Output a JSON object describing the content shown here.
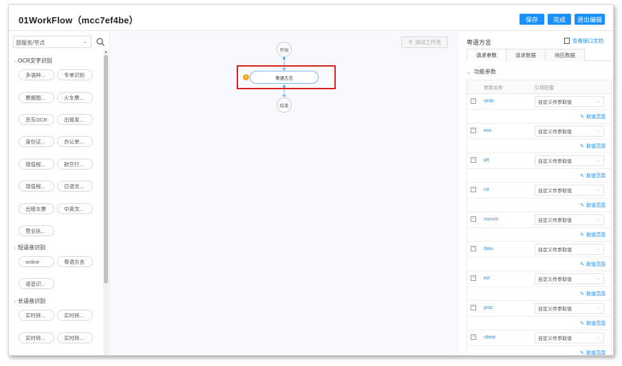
{
  "header": {
    "title": "01WorkFlow（mcc7ef4be）",
    "save_label": "保存",
    "done_label": "完成",
    "exit_label": "退出编辑"
  },
  "sidebar": {
    "select_value": "部服务/节点",
    "groups": [
      {
        "label": "OCR文字识别",
        "items": [
          "多语种...",
          "专单识别",
          "票据图...",
          "火车票...",
          "京东OCR",
          "出租发...",
          "身份证...",
          "办公单...",
          "增值税...",
          "航空行...",
          "增值税...",
          "日语文...",
          "出租车票",
          "中英文...",
          "营业执..."
        ]
      },
      {
        "label": "短语音识别",
        "items": [
          "online",
          "粤语方言",
          "语音识..."
        ]
      },
      {
        "label": "长语音识别",
        "items": [
          "实时转...",
          "实时转...",
          "实时转...",
          "实时转..."
        ]
      }
    ]
  },
  "canvas": {
    "test_button": "测试工作流",
    "start_label": "开始",
    "node_label": "粤语方言",
    "end_label": "结束",
    "warn_mark": "!"
  },
  "panel": {
    "title": "粤语方言",
    "doc_link": "查看接口文档",
    "tabs": [
      "请求参数",
      "请求数据",
      "响应数据"
    ],
    "section": "功能参数",
    "col_name": "参数名称",
    "col_ref": "引用配置",
    "range_label": "取值范围",
    "params": [
      {
        "name": "vinfo",
        "value": "自定义传参取值"
      },
      {
        "name": "eos",
        "value": "自定义传参取值"
      },
      {
        "name": "ptt",
        "value": "自定义传参取值"
      },
      {
        "name": "rst",
        "value": "自定义传参取值"
      },
      {
        "name": "nunum",
        "value": "自定义传参取值"
      },
      {
        "name": "dwa",
        "value": "自定义传参取值"
      },
      {
        "name": "evl",
        "value": "自定义传参取值"
      },
      {
        "name": "proc",
        "value": "自定义传参取值"
      },
      {
        "name": "nbest",
        "value": "自定义传参取值"
      }
    ]
  },
  "colors": {
    "accent": "#1890ff",
    "highlight": "#d81e1e",
    "warn": "#f5a623"
  }
}
